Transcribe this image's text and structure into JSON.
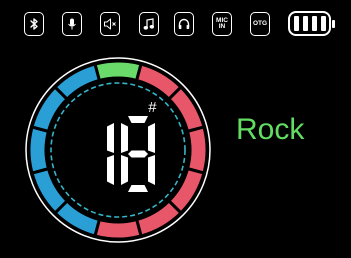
{
  "status_bar": {
    "icons": [
      {
        "name": "bluetooth-icon"
      },
      {
        "name": "microphone-icon"
      },
      {
        "name": "speaker-mute-icon"
      },
      {
        "name": "music-note-icon"
      },
      {
        "name": "headphones-icon"
      },
      {
        "name": "mic-in-icon",
        "line1": "MIC",
        "line2": "IN"
      },
      {
        "name": "otg-icon",
        "label": "OTG"
      }
    ],
    "battery": {
      "bars_filled": 4,
      "bars_total": 4
    }
  },
  "display": {
    "value": "18",
    "sharp_symbol": "#",
    "mode_label": "Rock"
  },
  "ring": {
    "segment_colors_clockwise_from_top": [
      "#6ada6a",
      "#e8566a",
      "#e8566a",
      "#e8566a",
      "#e8566a",
      "#e8566a",
      "#e8566a",
      "#2a9fd6",
      "#2a9fd6",
      "#2a9fd6",
      "#2a9fd6",
      "#2a9fd6"
    ],
    "colors": {
      "green": "#6ada6a",
      "red": "#e8566a",
      "blue": "#2a9fd6",
      "dashed_circle": "#35b6c8"
    }
  }
}
